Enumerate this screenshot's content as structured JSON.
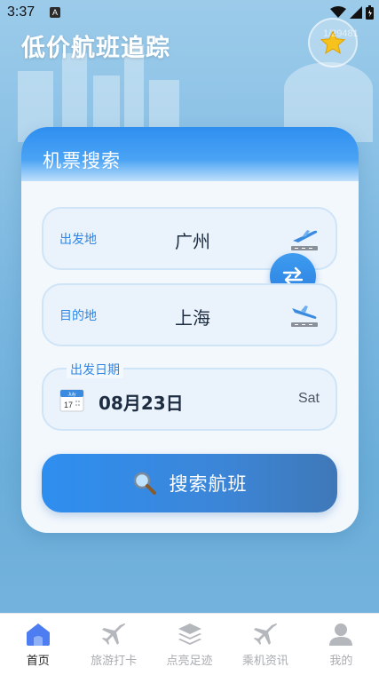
{
  "status_bar": {
    "time": "3:37",
    "notif_letter": "A"
  },
  "app": {
    "title": "低价航班追踪",
    "watermark": "1/29481"
  },
  "search_card": {
    "title": "机票搜索",
    "departure": {
      "label": "出发地",
      "value": "广州"
    },
    "destination": {
      "label": "目的地",
      "value": "上海"
    },
    "date": {
      "label": "出发日期",
      "value": "08月23日",
      "weekday": "Sat",
      "calendar_month": "July",
      "calendar_day": "17"
    },
    "search_button": {
      "label": "搜索航班",
      "icon": "magnifier-icon"
    }
  },
  "tabs": [
    {
      "label": "首页",
      "icon": "home-icon",
      "active": true
    },
    {
      "label": "旅游打卡",
      "icon": "plane-icon",
      "active": false
    },
    {
      "label": "点亮足迹",
      "icon": "layers-icon",
      "active": false
    },
    {
      "label": "乘机资讯",
      "icon": "plane-icon",
      "active": false
    },
    {
      "label": "我的",
      "icon": "user-icon",
      "active": false
    }
  ],
  "colors": {
    "accent": "#2f8ff0",
    "label_blue": "#2f86e6",
    "star": "#f7c21b"
  }
}
